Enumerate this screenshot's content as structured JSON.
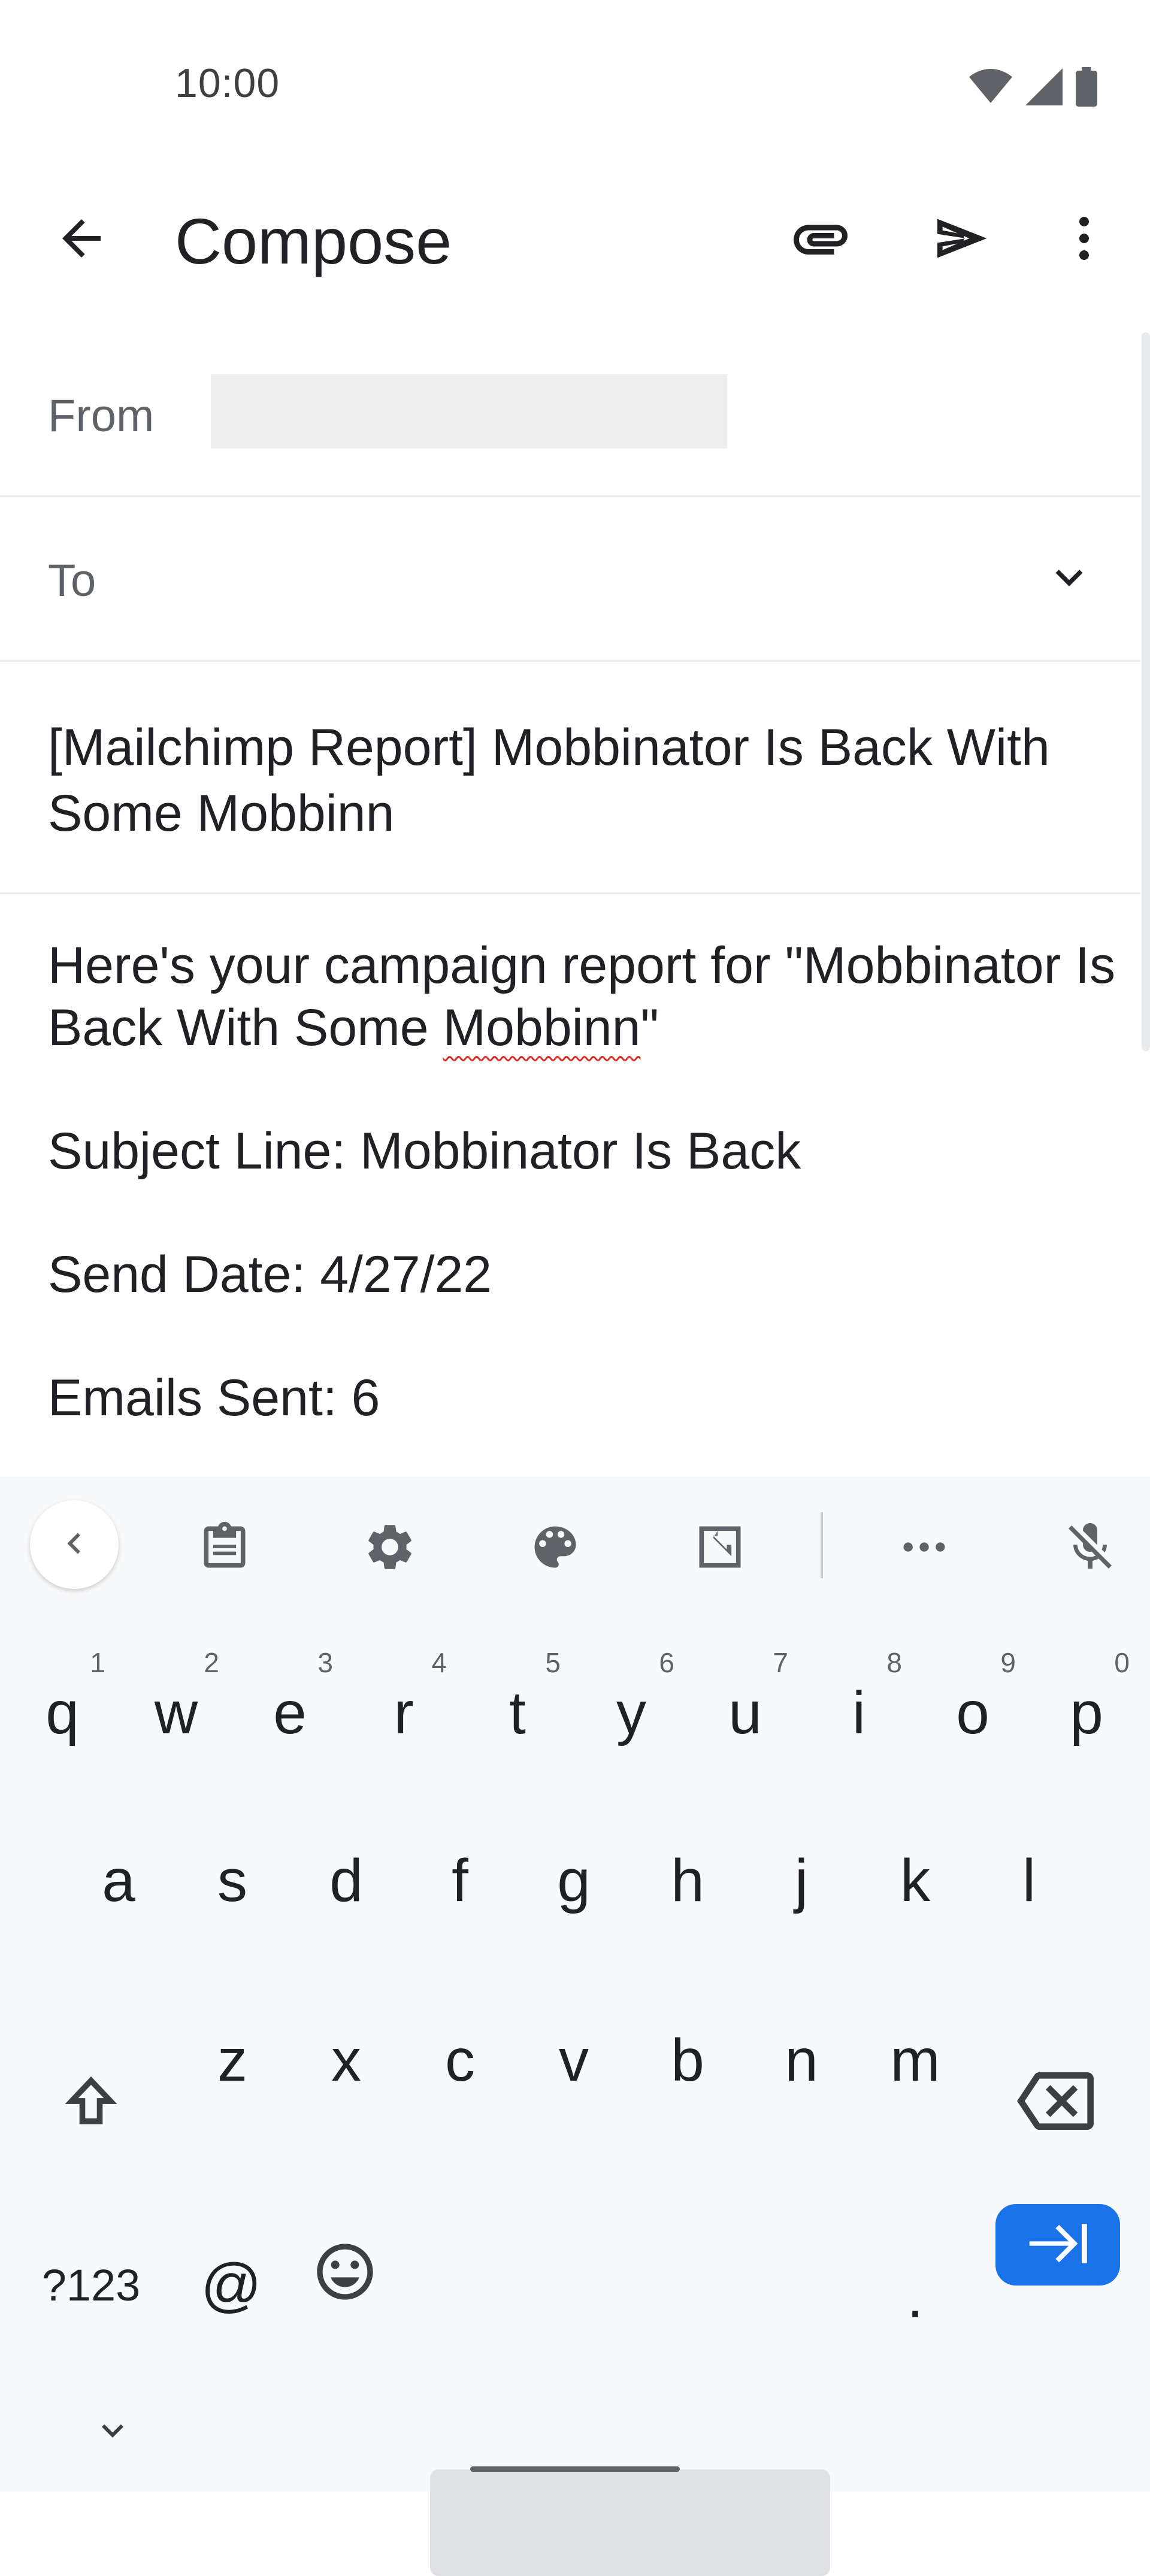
{
  "status_bar": {
    "time": "10:00",
    "icons": [
      "wifi-icon",
      "signal-icon",
      "battery-icon"
    ]
  },
  "app_bar": {
    "title": "Compose",
    "icons": [
      "back-arrow-icon",
      "attach-icon",
      "send-icon",
      "more-vert-icon"
    ]
  },
  "form": {
    "from_label": "From",
    "to_label": "To",
    "to_value": "",
    "subject": "[Mailchimp Report] Mobbinator Is Back With Some Mobbinn"
  },
  "body": {
    "line1_before": "Here's your campaign report for \"Mobbinator Is Back With Some ",
    "line1_misspelled": "Mobbinn",
    "line1_after": "\"",
    "subject_line": "Subject Line: Mobbinator Is Back",
    "send_date": "Send Date: 4/27/22",
    "emails_sent": "Emails Sent: 6"
  },
  "keyboard": {
    "toolbar_icons": [
      "chevron-left-icon",
      "clipboard-icon",
      "settings-icon",
      "palette-icon",
      "resize-icon",
      "more-horiz-icon",
      "mic-off-icon"
    ],
    "row1": [
      {
        "k": "q",
        "h": "1"
      },
      {
        "k": "w",
        "h": "2"
      },
      {
        "k": "e",
        "h": "3"
      },
      {
        "k": "r",
        "h": "4"
      },
      {
        "k": "t",
        "h": "5"
      },
      {
        "k": "y",
        "h": "6"
      },
      {
        "k": "u",
        "h": "7"
      },
      {
        "k": "i",
        "h": "8"
      },
      {
        "k": "o",
        "h": "9"
      },
      {
        "k": "p",
        "h": "0"
      }
    ],
    "row2": [
      "a",
      "s",
      "d",
      "f",
      "g",
      "h",
      "j",
      "k",
      "l"
    ],
    "row3": [
      "z",
      "x",
      "c",
      "v",
      "b",
      "n",
      "m"
    ],
    "symbols_label": "?123",
    "at_label": "@",
    "period_label": "."
  },
  "colors": {
    "accent": "#1a73e8",
    "text": "#202124",
    "secondary_text": "#5f6368",
    "divider": "#e8eaed",
    "spellcheck": "#d93025"
  }
}
